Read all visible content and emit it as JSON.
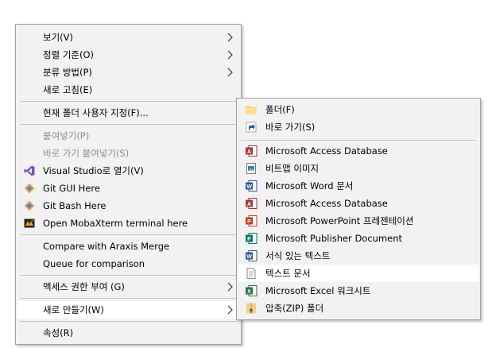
{
  "main_menu": {
    "items": [
      {
        "label": "보기(V)",
        "has_submenu": true
      },
      {
        "label": "정렬 기준(O)",
        "has_submenu": true
      },
      {
        "label": "분류 방법(P)",
        "has_submenu": true
      },
      {
        "label": "새로 고침(E)",
        "has_submenu": false
      },
      {
        "label": "현재 폴더 사용자 지정(F)...",
        "has_submenu": false
      },
      {
        "label": "붙여넣기(P)",
        "disabled": true
      },
      {
        "label": "바로 가기 붙여넣기(S)",
        "disabled": true
      },
      {
        "label": "Visual Studio로 열기(V)",
        "icon": "visual-studio-icon"
      },
      {
        "label": "Git GUI Here",
        "icon": "git-icon"
      },
      {
        "label": "Git Bash Here",
        "icon": "git-icon"
      },
      {
        "label": "Open MobaXterm terminal here",
        "icon": "mobaxterm-icon"
      },
      {
        "label": "Compare with Araxis Merge"
      },
      {
        "label": "Queue for comparison"
      },
      {
        "label": "액세스 권한 부여 (G)",
        "has_submenu": true
      },
      {
        "label": "새로 만들기(W)",
        "has_submenu": true,
        "highlighted": true
      },
      {
        "label": "속성(R)"
      }
    ]
  },
  "new_submenu": {
    "items": [
      {
        "label": "폴더(F)",
        "icon": "folder-icon"
      },
      {
        "label": "바로 가기(S)",
        "icon": "shortcut-icon"
      },
      {
        "label": "Microsoft Access Database",
        "icon": "access-icon"
      },
      {
        "label": "비트맵 이미지",
        "icon": "bitmap-icon"
      },
      {
        "label": "Microsoft Word 문서",
        "icon": "word-icon"
      },
      {
        "label": "Microsoft Access Database",
        "icon": "access-icon"
      },
      {
        "label": "Microsoft PowerPoint 프레젠테이션",
        "icon": "powerpoint-icon"
      },
      {
        "label": "Microsoft Publisher Document",
        "icon": "publisher-icon"
      },
      {
        "label": "서식 있는 텍스트",
        "icon": "rtf-icon"
      },
      {
        "label": "텍스트 문서",
        "icon": "text-document-icon",
        "highlighted": true
      },
      {
        "label": "Microsoft Excel 워크시트",
        "icon": "excel-icon"
      },
      {
        "label": "압축(ZIP) 폴더",
        "icon": "zip-folder-icon"
      }
    ]
  },
  "colors": {
    "menu_bg": "#f2f2f2",
    "hover_bg": "#ffffff",
    "disabled_text": "#8d8d8d",
    "separator": "#c6c6c6"
  }
}
